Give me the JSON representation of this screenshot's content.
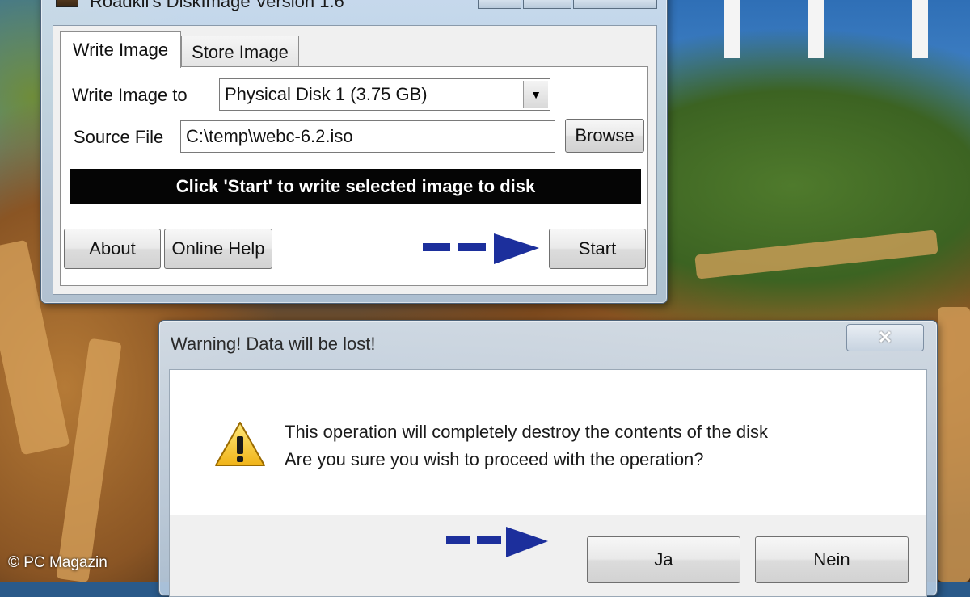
{
  "main_window": {
    "title": "Roadkil's DiskImage Version 1.6",
    "tabs": [
      {
        "label": "Write Image",
        "active": true
      },
      {
        "label": "Store Image",
        "active": false
      }
    ],
    "write_image_to_label": "Write Image to",
    "write_image_to_value": "Physical Disk 1 (3.75 GB)",
    "source_file_label": "Source File",
    "source_file_value": "C:\\temp\\webc-6.2.iso",
    "browse_label": "Browse",
    "status_text": "Click 'Start' to write selected image to disk",
    "about_label": "About",
    "online_help_label": "Online Help",
    "start_label": "Start"
  },
  "warning_dialog": {
    "title": "Warning! Data will be lost!",
    "close_glyph": "✕",
    "icon": "warning-icon",
    "message_line1": "This operation will completely destroy the contents of the disk",
    "message_line2": "Are you sure you wish to proceed with the operation?",
    "yes_label": "Ja",
    "no_label": "Nein"
  },
  "annotations": {
    "arrow_color": "#1c2f9c"
  },
  "copyright": "© PC Magazin"
}
